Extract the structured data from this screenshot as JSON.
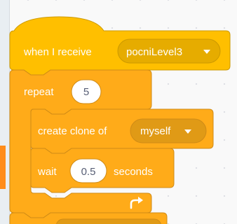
{
  "hat_block": {
    "label": "when I receive",
    "message": "pocniLevel3"
  },
  "repeat_block": {
    "label": "repeat",
    "count": "5"
  },
  "clone_block": {
    "label": "create clone of",
    "target": "myself"
  },
  "wait_block": {
    "label": "wait",
    "duration": "0.5",
    "unit_label": "seconds"
  },
  "icons": {
    "dropdown": "chevron-down-icon",
    "loop_arrow": "repeat-arrow-icon"
  },
  "colors": {
    "control_fill": "#ffab19",
    "control_stroke": "#cf8b17",
    "control_dark": "#e09a16",
    "events_fill": "#ffbf00",
    "events_stroke": "#cc9900",
    "events_dark": "#e6ac00",
    "input_text": "#575e75"
  }
}
